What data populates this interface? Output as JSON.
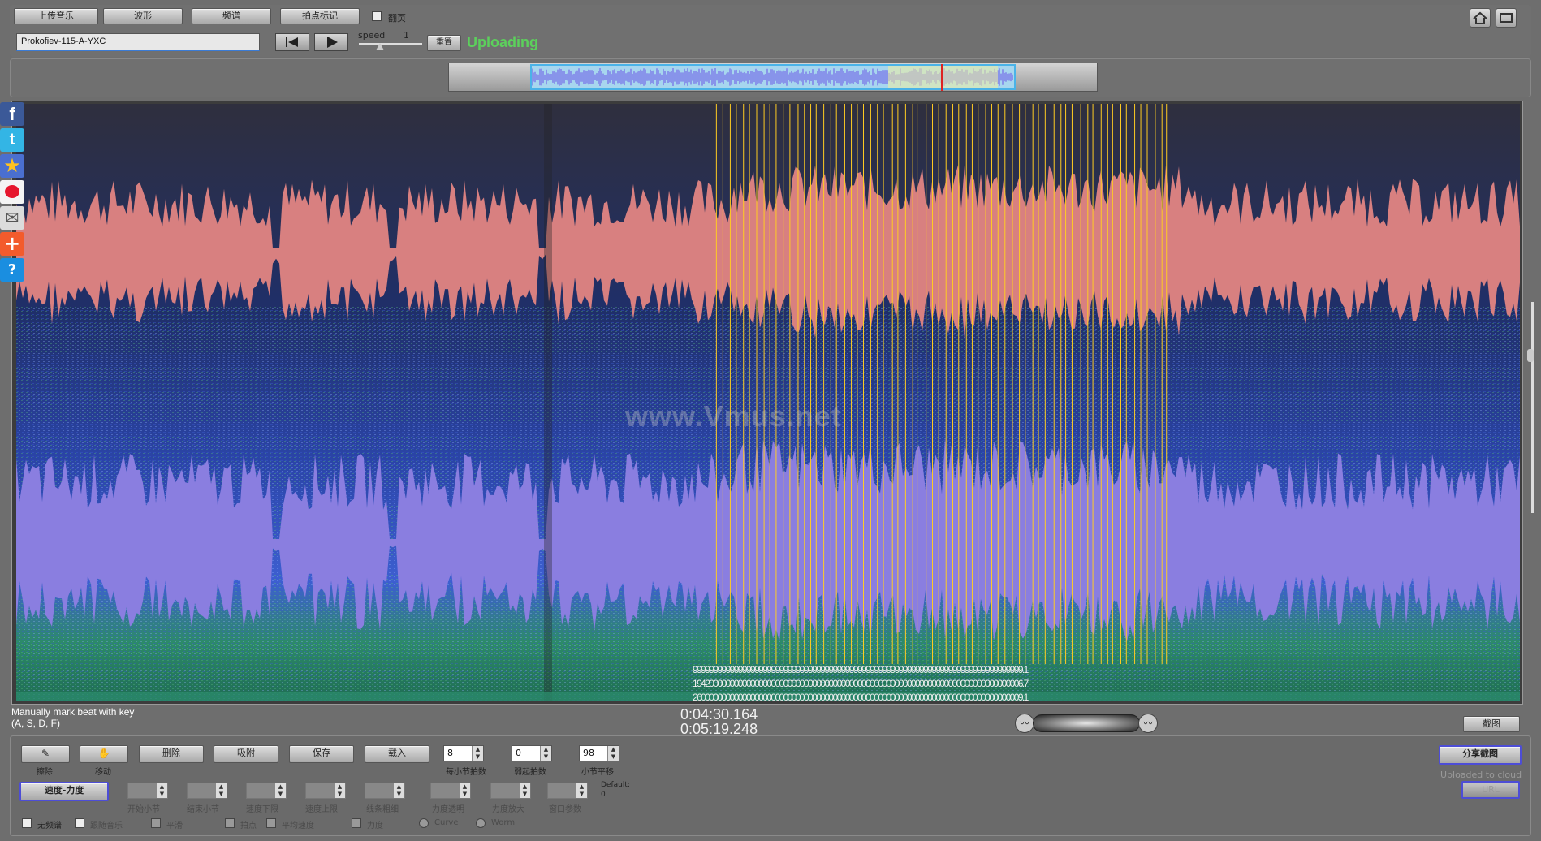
{
  "toolbar": {
    "upload_label": "上传音乐",
    "waveform_label": "波形",
    "spectrum_label": "频谱",
    "beat_mark_label": "拍点标记",
    "page_turn_label": "翻页",
    "file_name": "Prokofiev-115-A-YXC",
    "speed_label": "speed",
    "speed_value": "1",
    "reset_label": "重置",
    "status": "Uploading"
  },
  "spectrogram": {
    "watermark": "www.Vmus.net",
    "beat_labels_row1": "99999999999999999999999999999999999999999999999999999999999999999999999999999999.1",
    "beat_labels_row2": "19420000000000000000000000000000000000000000000000000000000000000000000000000006.7",
    "beat_labels_row3": "26000000000000000000000000000000000000000000000000000000000000000000000000000009.1"
  },
  "info": {
    "hint_line1": "Manually mark beat with key",
    "hint_line2": "(A, S, D, F)",
    "current_time": "0:04:30.164",
    "total_time": "0:05:19.248",
    "screenshot_label": "截图"
  },
  "bottom": {
    "erase_label": "擦除",
    "move_label": "移动",
    "delete_label": "删除",
    "snap_label": "吸附",
    "save_label": "保存",
    "load_label": "载入",
    "beats_per_bar_value": "8",
    "beats_per_bar_label": "每小节拍数",
    "pickup_value": "0",
    "pickup_label": "弱起拍数",
    "bar_shift_value": "98",
    "bar_shift_label": "小节平移",
    "tempo_dynamics_label": "速度-力度",
    "start_bar_label": "开始小节",
    "end_bar_label": "结束小节",
    "tempo_min_label": "速度下限",
    "tempo_max_label": "速度上限",
    "line_thickness_label": "线条粗细",
    "dyn_transparency_label": "力度透明",
    "dyn_zoom_label": "力度放大",
    "window_param_label": "窗口参数",
    "default_label": "Default:",
    "default_value": "0",
    "no_spectrum_label": "无频谱",
    "follow_music_label": "跟随音乐",
    "smooth_label": "平滑",
    "beats_label": "拍点",
    "avg_tempo_label": "平均速度",
    "dynamics_label": "力度",
    "curve_label": "Curve",
    "worm_label": "Worm",
    "share_label": "分享截图",
    "uploaded_label": "Uploaded to cloud",
    "url_label": "URL"
  },
  "icons": [
    "facebook-icon",
    "twitter-icon",
    "star-icon",
    "weibo-icon",
    "mail-icon",
    "plus-icon",
    "help-icon",
    "home-icon",
    "fullscreen-icon",
    "zoom-out-icon",
    "zoom-in-icon",
    "eraser-icon",
    "move-icon",
    "prev-icon",
    "play-icon"
  ],
  "colors": {
    "status": "#5cd05c",
    "beat_line": "#ffcc22",
    "marker": "#dd2222",
    "overview_window": "#a7d6ee"
  }
}
